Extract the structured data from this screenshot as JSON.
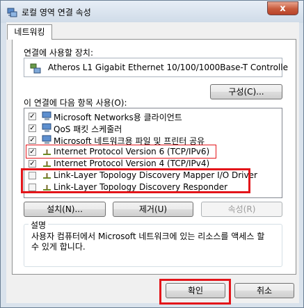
{
  "window": {
    "title": "로컬 영역 연결 속성",
    "close_glyph": "x"
  },
  "tabs": [
    {
      "label": "네트워킹",
      "selected": true
    }
  ],
  "connect_using": {
    "label": "연결에 사용할 장치:",
    "adapter_name": "Atheros L1 Gigabit Ethernet 10/100/1000Base-T Controlle",
    "configure_label": "구성(C)..."
  },
  "components": {
    "label": "이 연결에 다음 항목 사용(O):",
    "items": [
      {
        "label": "Microsoft Networks용 클라이언트",
        "checked": true,
        "icon": "network-client-icon"
      },
      {
        "label": "QoS 패킷 스케줄러",
        "checked": true,
        "icon": "qos-icon"
      },
      {
        "label": "Microsoft 네트워크용 파일 및 프린터 공유",
        "checked": true,
        "icon": "file-share-icon"
      },
      {
        "label": "Internet Protocol Version 6 (TCP/IPv6)",
        "checked": true,
        "icon": "protocol-icon"
      },
      {
        "label": "Internet Protocol Version 4 (TCP/IPv4)",
        "checked": true,
        "icon": "protocol-icon"
      },
      {
        "label": "Link-Layer Topology Discovery Mapper I/O Driver",
        "checked": false,
        "icon": "protocol-icon"
      },
      {
        "label": "Link-Layer Topology Discovery Responder",
        "checked": false,
        "icon": "protocol-icon"
      }
    ]
  },
  "actions": {
    "install": "설치(N)...",
    "uninstall": "제거(U)",
    "properties": "속성(R)"
  },
  "description": {
    "title": "설명",
    "text": "사용자 컴퓨터에서 Microsoft 네트워크에 있는 리소스를 액세스 할 수 있게 합니다."
  },
  "footer": {
    "ok": "확인",
    "cancel": "취소"
  },
  "colors": {
    "highlight_red": "#e3151a",
    "title_bg": "#dbe5f1"
  }
}
